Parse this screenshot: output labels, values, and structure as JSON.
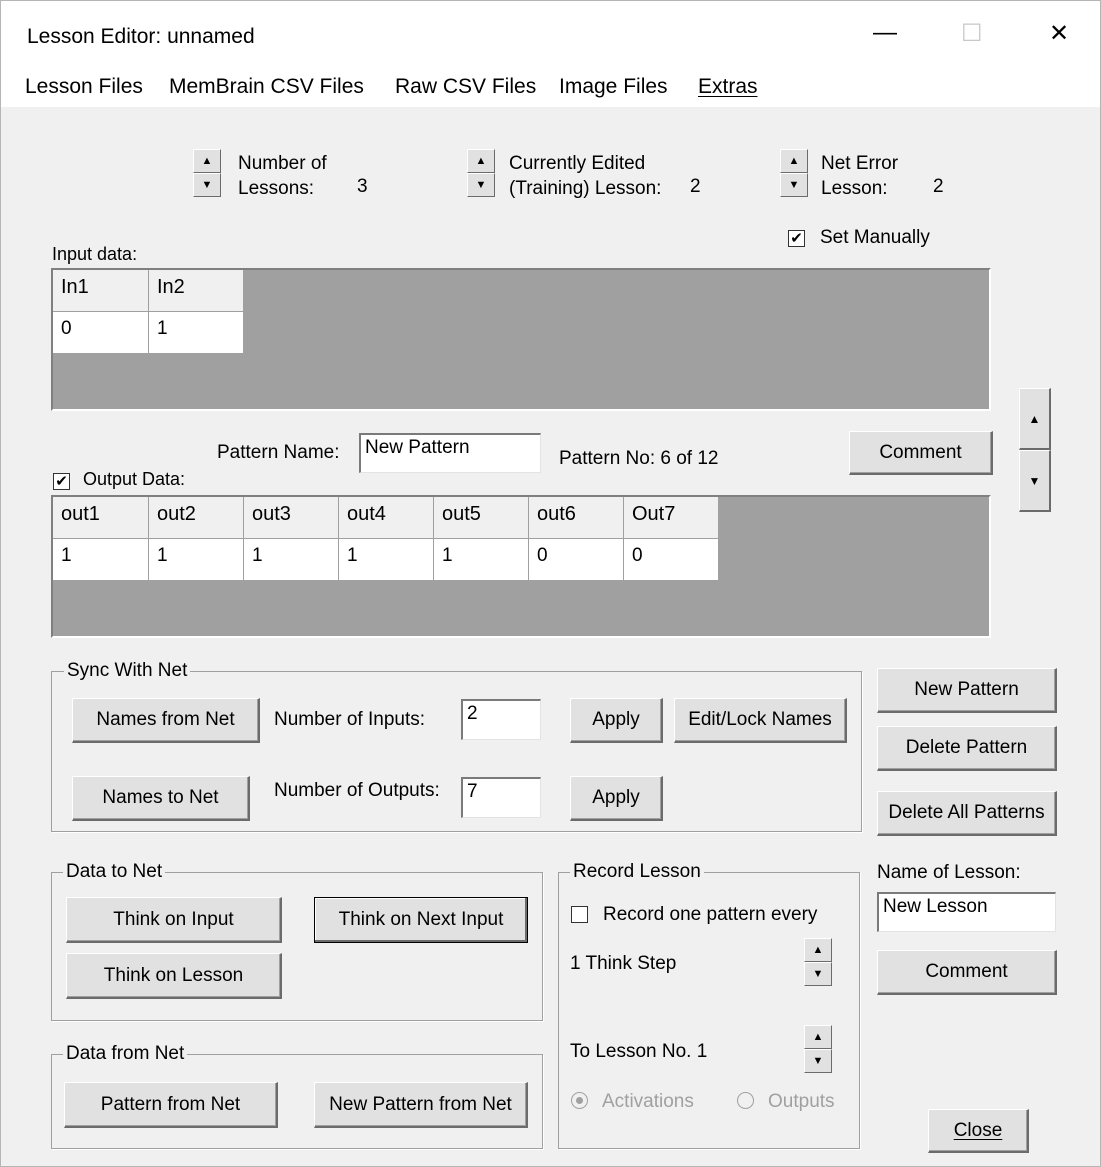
{
  "window": {
    "title": "Lesson Editor: unnamed",
    "minimize": "—",
    "maximize": "☐",
    "close": "✕"
  },
  "menu": [
    "Lesson Files",
    "MemBrain CSV Files",
    "Raw CSV Files",
    "Image Files",
    "Extras"
  ],
  "counters": {
    "num_lessons_label": "Number of\nLessons:",
    "num_lessons_value": "3",
    "current_lesson_label": "Currently Edited\n(Training) Lesson:",
    "current_lesson_value": "2",
    "net_error_label": "Net Error\nLesson:",
    "net_error_value": "2",
    "set_manually_label": "Set Manually",
    "set_manually_checked": true
  },
  "input_data": {
    "label": "Input data:",
    "columns": [
      "In1",
      "In2"
    ],
    "row": [
      "0",
      "1"
    ]
  },
  "pattern": {
    "name_label": "Pattern Name:",
    "name_value": "New Pattern",
    "number_text": "Pattern No: 6 of 12",
    "comment_button": "Comment"
  },
  "output_data": {
    "label": "Output Data:",
    "checked": true,
    "columns": [
      "out1",
      "out2",
      "out3",
      "out4",
      "out5",
      "out6",
      "Out7"
    ],
    "row": [
      "1",
      "1",
      "1",
      "1",
      "1",
      "0",
      "0"
    ]
  },
  "sync": {
    "group_label": "Sync With Net",
    "names_from_net": "Names from Net",
    "names_to_net": "Names to Net",
    "num_inputs_label": "Number of Inputs:",
    "num_inputs_value": "2",
    "num_outputs_label": "Number of Outputs:",
    "num_outputs_value": "7",
    "apply": "Apply",
    "edit_lock_names": "Edit/Lock Names"
  },
  "pattern_buttons": {
    "new_pattern": "New Pattern",
    "delete_pattern": "Delete Pattern",
    "delete_all_patterns": "Delete All Patterns"
  },
  "data_to_net": {
    "group_label": "Data to Net",
    "think_on_input": "Think on Input",
    "think_on_next_input": "Think on Next Input",
    "think_on_lesson": "Think on Lesson"
  },
  "data_from_net": {
    "group_label": "Data from Net",
    "pattern_from_net": "Pattern from Net",
    "new_pattern_from_net": "New Pattern from Net"
  },
  "record_lesson": {
    "group_label": "Record Lesson",
    "record_checkbox_label": "Record one pattern every",
    "record_checked": false,
    "think_step_text": "1 Think Step",
    "to_lesson_text": "To Lesson No. 1",
    "activations_label": "Activations",
    "outputs_label": "Outputs"
  },
  "lesson_name": {
    "label": "Name of Lesson:",
    "value": "New Lesson",
    "comment_button": "Comment",
    "close_button": "Close"
  }
}
